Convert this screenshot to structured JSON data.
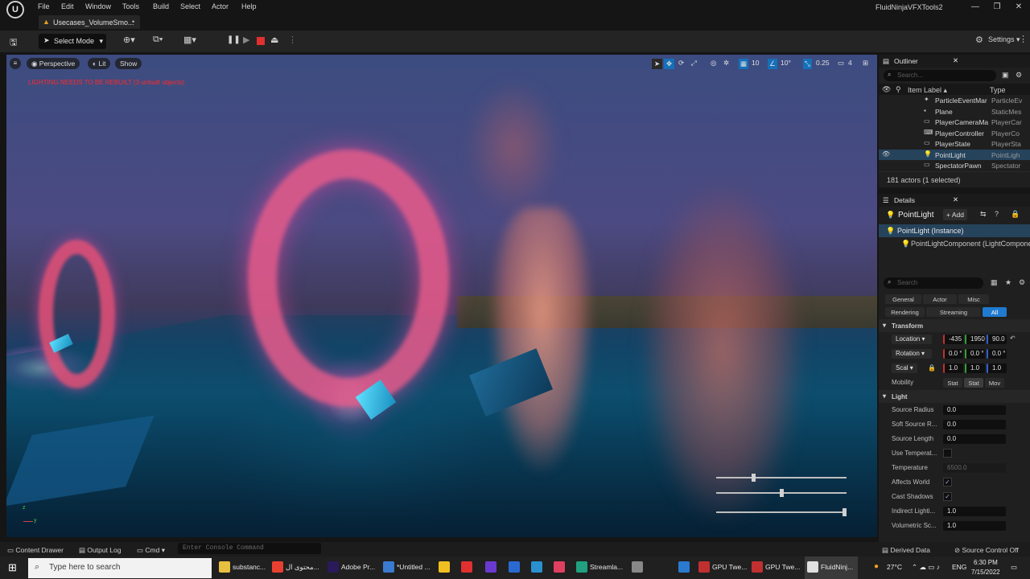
{
  "menu": [
    "File",
    "Edit",
    "Window",
    "Tools",
    "Build",
    "Select",
    "Actor",
    "Help"
  ],
  "project_name": "FluidNinjaVFXTools2",
  "window_controls": [
    "—",
    "❐",
    "✕"
  ],
  "tab": {
    "label": "Usecases_VolumeSmo...",
    "close": "•"
  },
  "toolbar": {
    "select_mode": "Select Mode",
    "settings": "Settings"
  },
  "viewport": {
    "perspective": "Perspective",
    "lit": "Lit",
    "show": "Show",
    "warning": "LIGHTING NEEDS TO BE REBUILT (3 unbuilt objects)",
    "grid_snap": "10",
    "rot_snap": "10°",
    "scale_snap": "0.25",
    "camera_speed": "4",
    "axis_z": "z",
    "axis_y": "y",
    "sliders": [
      0.28,
      0.5,
      1.0
    ]
  },
  "outliner": {
    "title": "Outliner",
    "search_placeholder": "Search...",
    "col_label": "Item Label ▴",
    "col_type": "Type",
    "rows": [
      {
        "name": "ParticleEventMar",
        "type": "ParticleEv",
        "icon": "particle-icon"
      },
      {
        "name": "Plane",
        "type": "StaticMes",
        "icon": "mesh-icon"
      },
      {
        "name": "PlayerCameraMa",
        "type": "PlayerCar",
        "icon": "camera-icon"
      },
      {
        "name": "PlayerController",
        "type": "PlayerCo",
        "icon": "controller-icon"
      },
      {
        "name": "PlayerState",
        "type": "PlayerSta",
        "icon": "state-icon"
      },
      {
        "name": "PointLight",
        "type": "PointLigh",
        "icon": "light-icon",
        "selected": true
      },
      {
        "name": "SpectatorPawn",
        "type": "Spectator",
        "icon": "pawn-icon"
      }
    ],
    "status": "181 actors (1 selected)"
  },
  "details": {
    "title": "Details",
    "actor_name": "PointLight",
    "add_label": "+ Add",
    "instance": "PointLight (Instance)",
    "component": "PointLightComponent (LightCompone",
    "search_placeholder": "Search",
    "filters_row1": [
      "General",
      "Actor",
      "Misc"
    ],
    "filters_row2": [
      "Rendering",
      "Streaming",
      "All"
    ],
    "transform_header": "Transform",
    "location_label": "Location",
    "location": [
      "-435",
      "1950",
      "90.0"
    ],
    "rotation_label": "Rotation",
    "rotation": [
      "0.0 °",
      "0.0 °",
      "0.0 °"
    ],
    "scale_label": "Scal",
    "scale": [
      "1.0",
      "1.0",
      "1.0"
    ],
    "mobility_label": "Mobility",
    "mobility": [
      "Stat",
      "Stat",
      "Mov"
    ],
    "light_header": "Light",
    "props": [
      {
        "label": "Source Radius",
        "value": "0.0",
        "kind": "field"
      },
      {
        "label": "Soft Source R...",
        "value": "0.0",
        "kind": "field"
      },
      {
        "label": "Source Length",
        "value": "0.0",
        "kind": "field"
      },
      {
        "label": "Use Temperat...",
        "value": "",
        "kind": "check"
      },
      {
        "label": "Temperature",
        "value": "6500.0",
        "kind": "field-dim"
      },
      {
        "label": "Affects World",
        "value": "✓",
        "kind": "check"
      },
      {
        "label": "Cast Shadows",
        "value": "✓",
        "kind": "check"
      },
      {
        "label": "Indirect Lighti...",
        "value": "1.0",
        "kind": "field"
      },
      {
        "label": "Volumetric Sc...",
        "value": "1.0",
        "kind": "field"
      }
    ]
  },
  "bottombar": {
    "content_drawer": "Content Drawer",
    "output_log": "Output Log",
    "cmd": "Cmd",
    "console_placeholder": "Enter Console Command",
    "derived_data": "Derived Data",
    "source_control": "Source Control Off"
  },
  "taskbar": {
    "search_placeholder": "Type here to search",
    "apps": [
      {
        "label": "substanc...",
        "color": "#e8c040"
      },
      {
        "label": "محتوى ال...",
        "color": "#e84030"
      },
      {
        "label": "Adobe Pr...",
        "color": "#2a1a5a"
      },
      {
        "label": "*Untitled ...",
        "color": "#3a7ad0"
      },
      {
        "label": "Streamla...",
        "color": "#20a080"
      },
      {
        "label": "GPU Twe...",
        "color": "#c03030"
      },
      {
        "label": "GPU Twe...",
        "color": "#c03030"
      },
      {
        "label": "FluidNinj...",
        "color": "#e0e0e0"
      }
    ],
    "weather": "27°C",
    "lang": "ENG",
    "time": "6:30 PM",
    "date": "7/15/2022"
  }
}
